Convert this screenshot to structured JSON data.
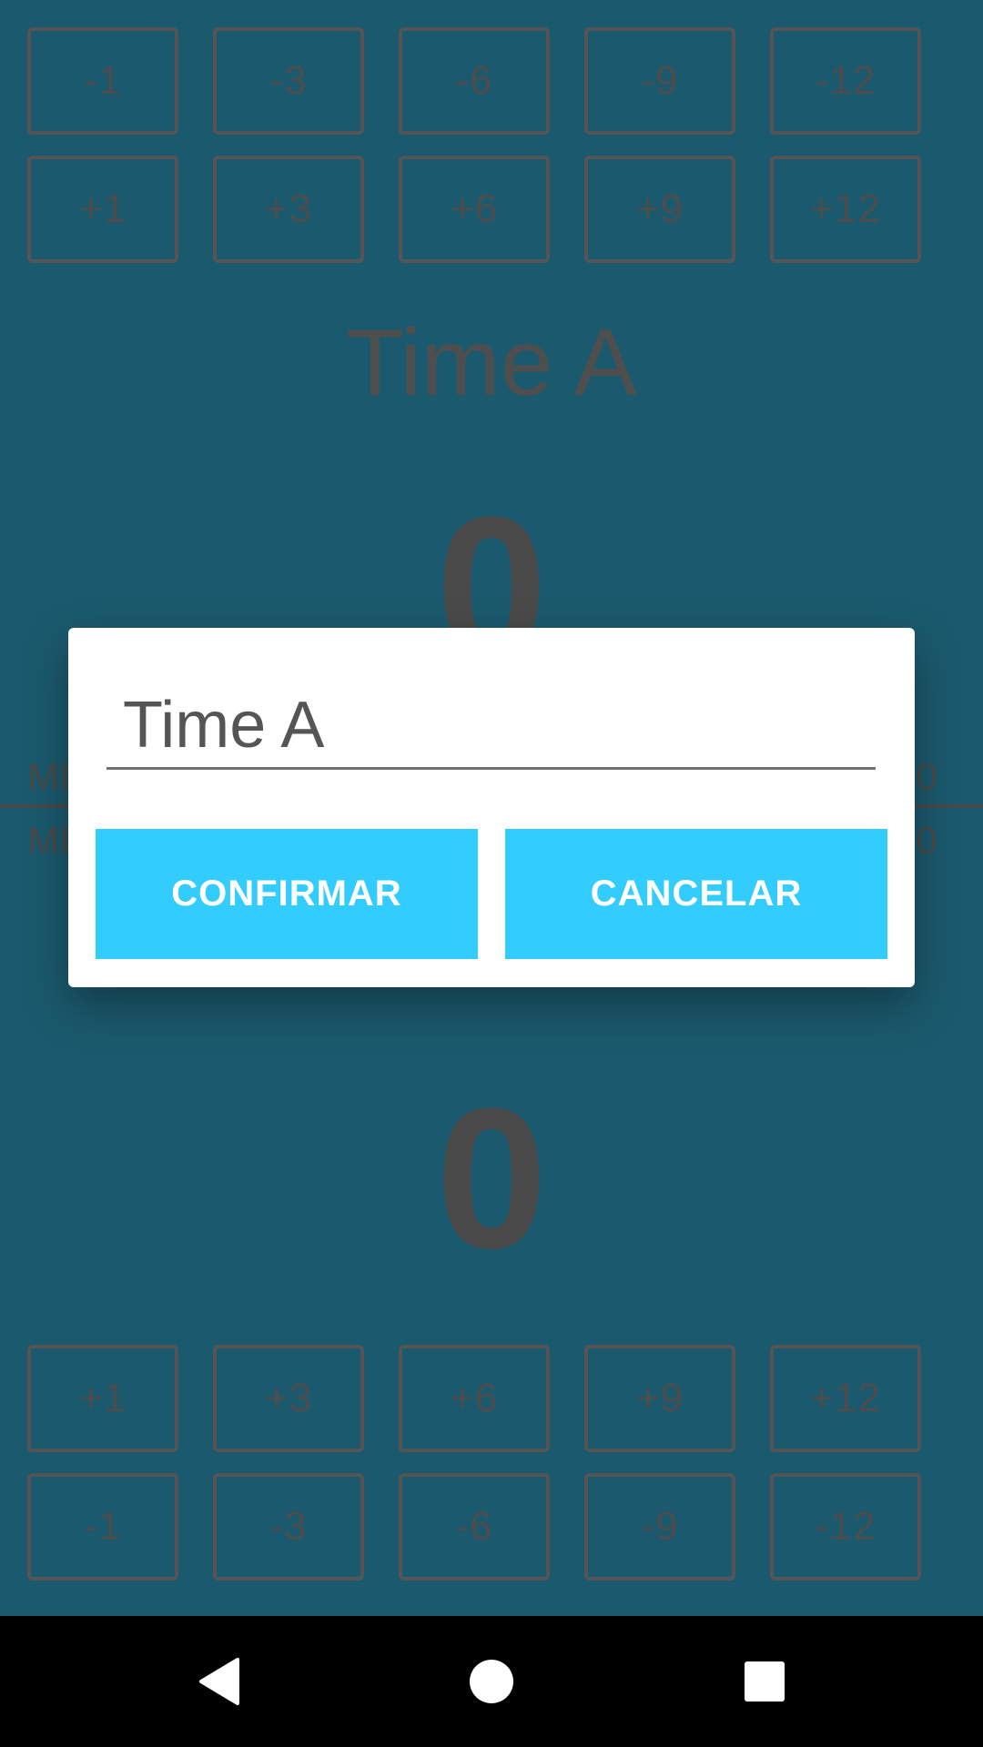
{
  "team_a": {
    "name": "Time A",
    "score": "0",
    "minus_buttons": [
      "-1",
      "-3",
      "-6",
      "-9",
      "-12"
    ],
    "plus_buttons": [
      "+1",
      "+3",
      "+6",
      "+9",
      "+12"
    ]
  },
  "team_b": {
    "score": "0",
    "plus_buttons": [
      "+1",
      "+3",
      "+6",
      "+9",
      "+12"
    ],
    "minus_buttons": [
      "-1",
      "-3",
      "-6",
      "-9",
      "-12"
    ]
  },
  "side_labels": {
    "left_top": "MI",
    "left_bottom": "MI",
    "right_top": "0",
    "right_bottom": "0"
  },
  "dialog": {
    "input_value": "Time A",
    "confirm_label": "CONFIRMAR",
    "cancel_label": "CANCELAR"
  },
  "colors": {
    "background": "#1b5a6e",
    "accent": "#33ccff"
  },
  "icons": {
    "back": "back-icon",
    "home": "home-icon",
    "recents": "recents-icon"
  }
}
